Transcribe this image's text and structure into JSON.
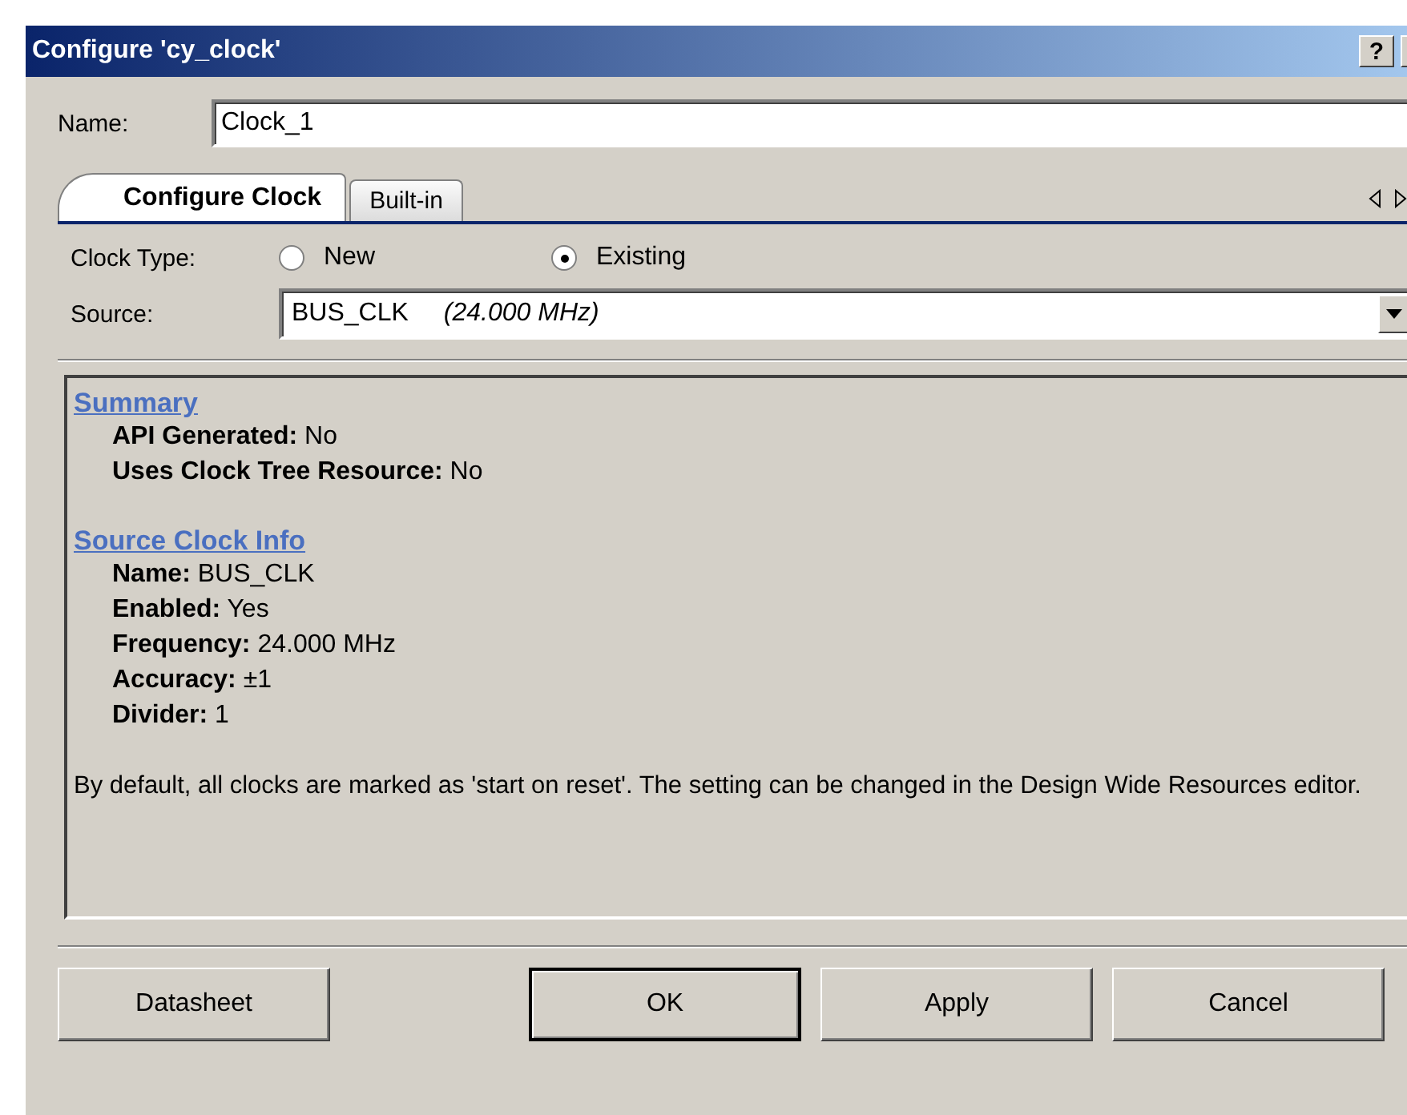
{
  "window": {
    "title": "Configure 'cy_clock'",
    "help_button": "?"
  },
  "name_field": {
    "label": "Name:",
    "value": "Clock_1"
  },
  "tabs": [
    {
      "label": "Configure Clock",
      "selected": true
    },
    {
      "label": "Built-in",
      "selected": false
    }
  ],
  "clock_type": {
    "label": "Clock Type:",
    "options": [
      {
        "label": "New",
        "selected": false
      },
      {
        "label": "Existing",
        "selected": true
      }
    ]
  },
  "source": {
    "label": "Source:",
    "value": "BUS_CLK",
    "detail": "(24.000 MHz)"
  },
  "info": {
    "sections": [
      {
        "heading": "Summary",
        "rows": [
          {
            "label": "API Generated:",
            "value": "No"
          },
          {
            "label": "Uses Clock Tree Resource:",
            "value": "No"
          }
        ]
      },
      {
        "heading": "Source Clock Info",
        "rows": [
          {
            "label": "Name:",
            "value": "BUS_CLK"
          },
          {
            "label": "Enabled:",
            "value": "Yes"
          },
          {
            "label": "Frequency:",
            "value": "24.000 MHz"
          },
          {
            "label": "Accuracy:",
            "value": "±1"
          },
          {
            "label": "Divider:",
            "value": "1"
          }
        ]
      }
    ],
    "note": "By default, all clocks are marked as 'start on reset'. The setting can be changed in the Design Wide Resources editor."
  },
  "buttons": [
    {
      "label": "Datasheet",
      "default": false
    },
    {
      "label": "OK",
      "default": true
    },
    {
      "label": "Apply",
      "default": false
    },
    {
      "label": "Cancel",
      "default": false
    }
  ]
}
